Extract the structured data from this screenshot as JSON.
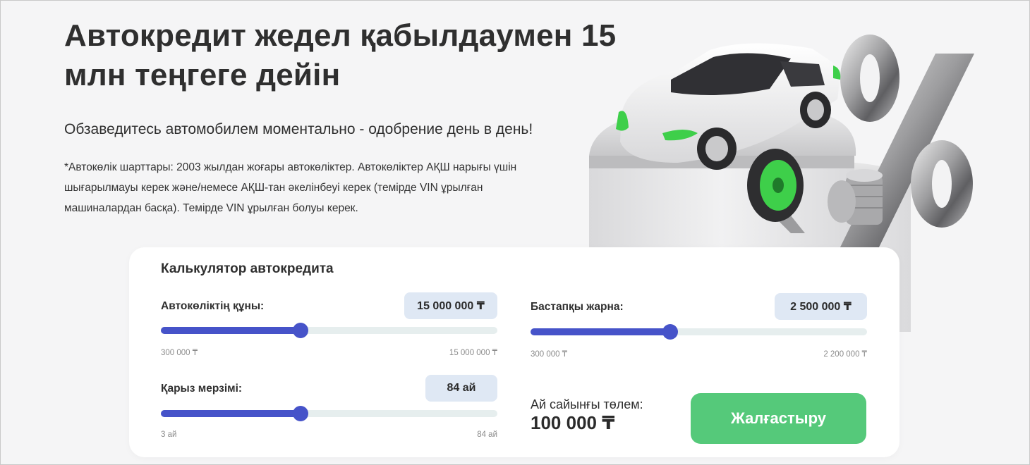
{
  "hero": {
    "title": "Автокредит жедел қабылдаумен 15 млн теңгеге дейін",
    "subtitle": "Обзаведитесь автомобилем моментально - одобрение день в день!",
    "note": "*Автокөлік шарттары: 2003 жылдан жоғары автокөліктер. Автокөліктер АҚШ нарығы үшін шығарылмауы керек және/немесе АҚШ-тан әкелінбеуі керек (темірде VIN ұрылған машиналардан басқа). Темірде VIN ұрылған болуы керек."
  },
  "illustration": {
    "icons": [
      "car-icon",
      "tire-icon",
      "coins-icon",
      "percent-icon"
    ],
    "accent": "#3ecf4a"
  },
  "calculator": {
    "title": "Калькулятор автокредита",
    "car_price": {
      "label": "Автокөліктің құны:",
      "value": "15 000 000 ₸",
      "min": "300 000 ₸",
      "max": "15 000 000 ₸",
      "fill_fraction": 0.415
    },
    "down_payment": {
      "label": "Бастапқы жарна:",
      "value": "2 500 000 ₸",
      "min": "300 000 ₸",
      "max": "2 200 000 ₸",
      "fill_fraction": 0.415
    },
    "term": {
      "label": "Қарыз мерзімі:",
      "value": "84 ай",
      "min": "3 ай",
      "max": "84 ай",
      "fill_fraction": 0.415
    },
    "monthly_payment": {
      "label": "Ай сайынғы төлем:",
      "value": "100 000 ₸"
    },
    "continue_label": "Жалғастыру"
  },
  "colors": {
    "slider_accent": "#4653c9",
    "button": "#55c97a",
    "pill_bg": "#dfe8f4",
    "page_bg": "#f5f5f6"
  }
}
